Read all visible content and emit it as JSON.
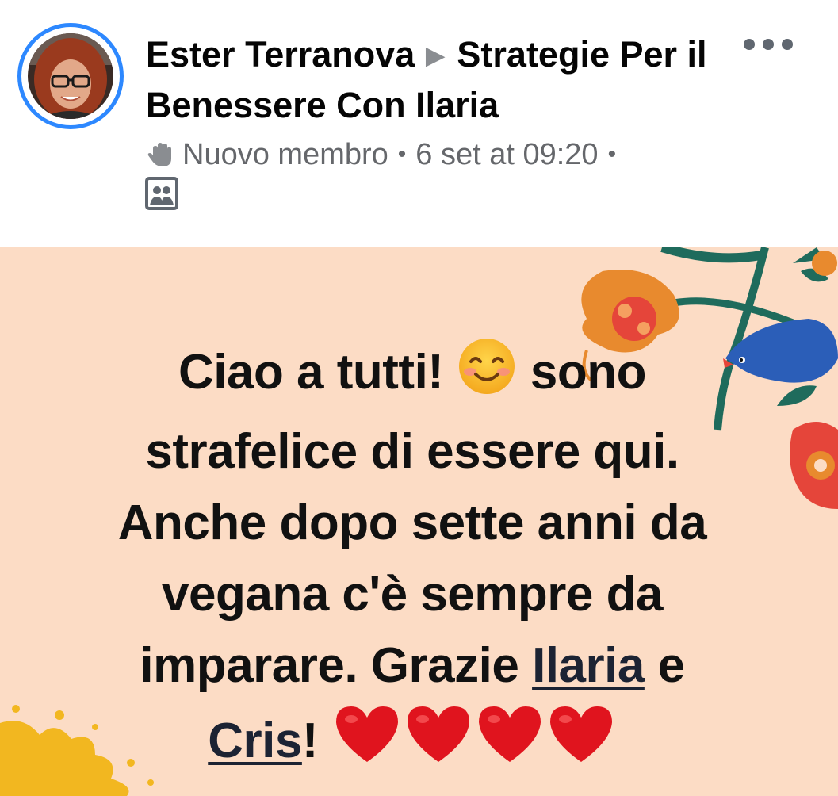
{
  "post_header": {
    "author": "Ester Terranova",
    "arrow": "▶",
    "group": "Strategie Per il Benessere Con Ilaria",
    "badge_label": "Nuovo membro",
    "dot": "•",
    "timestamp": "6 set at 09:20"
  },
  "post_body": {
    "line1_pre": "Ciao a tutti!",
    "line1_post": "sono",
    "line2": "strafelice di essere qui.",
    "line3": "Anche dopo sette anni da",
    "line4": "vegana c'è sempre da",
    "line5_pre": "imparare. Grazie",
    "mention1": "Ilaria",
    "line5_post": "e",
    "mention2": "Cris",
    "line6_post": "!",
    "background_color": "#fcdcc5"
  },
  "icons": {
    "badge_icon": "waving-hand-icon",
    "audience_icon": "group-members-icon",
    "more_icon": "more-options-icon",
    "emoji_smile": "smiling-face-icon",
    "emoji_hearts": "red-heart-icon"
  },
  "colors": {
    "accent": "#2d88ff",
    "secondary_text": "#65676b",
    "heart": "#e0141e"
  }
}
